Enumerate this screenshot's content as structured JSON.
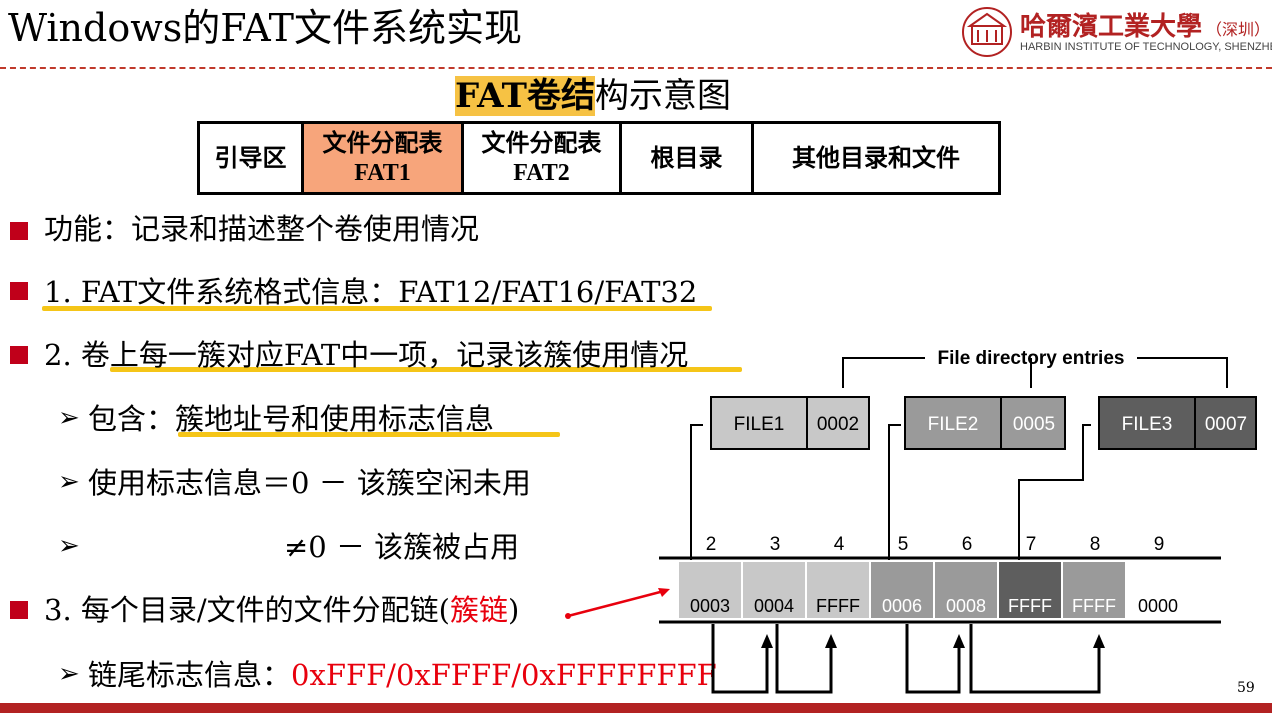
{
  "slide": {
    "title": "Windows的FAT文件系统实现",
    "page_number": "59"
  },
  "logo": {
    "cn_name": "哈爾濱工業大學",
    "cn_suffix": "（深圳）",
    "en_name": "HARBIN INSTITUTE OF TECHNOLOGY, SHENZHEN"
  },
  "volume": {
    "title_highlight": "FAT卷结",
    "title_rest": "构示意图",
    "cells": [
      {
        "line1": "引导区",
        "line2": ""
      },
      {
        "line1": "文件分配表",
        "line2": "FAT1"
      },
      {
        "line1": "文件分配表",
        "line2": "FAT2"
      },
      {
        "line1": "根目录",
        "line2": ""
      },
      {
        "line1": "其他目录和文件",
        "line2": ""
      }
    ]
  },
  "bullets": {
    "b1": "功能：记录和描述整个卷使用情况",
    "b2": "1. FAT文件系统格式信息：FAT12/FAT16/FAT32",
    "b3": "2. 卷上每一簇对应FAT中一项，记录该簇使用情况",
    "s1": "包含：簇地址号和使用标志信息",
    "s2": "使用标志信息＝0 － 该簇空闲未用",
    "s3": "≠0 － 该簇被占用",
    "b4_pre": "3. 每个目录/文件的文件分配链(",
    "b4_red": "簇链",
    "b4_post": ")",
    "s4_pre": "链尾标志信息：",
    "s4_red": "0xFFF/0xFFFF/0xFFFFFFFF"
  },
  "diagram": {
    "header": "File directory entries",
    "files": [
      {
        "name": "FILE1",
        "start": "0002"
      },
      {
        "name": "FILE2",
        "start": "0005"
      },
      {
        "name": "FILE3",
        "start": "0007"
      }
    ],
    "cluster_numbers": [
      "2",
      "3",
      "4",
      "5",
      "6",
      "7",
      "8",
      "9"
    ],
    "cluster_values": [
      "0003",
      "0004",
      "FFFF",
      "0006",
      "0008",
      "FFFF",
      "FFFF",
      "0000"
    ]
  },
  "colors": {
    "accent_red": "#c0001a",
    "highlight_yellow": "#f5c518",
    "fat1_fill": "#f7a57b"
  }
}
